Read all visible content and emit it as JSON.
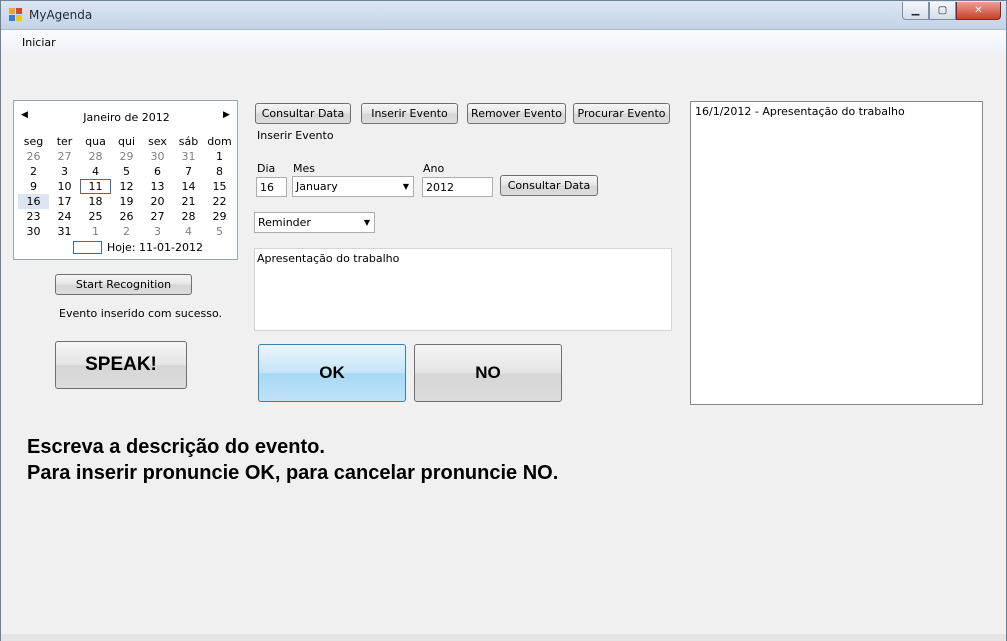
{
  "window": {
    "title": "MyAgenda",
    "minimize_icon": "minimize-icon",
    "maximize_icon": "maximize-icon",
    "close_icon": "close-icon"
  },
  "menu": {
    "iniciar": "Iniciar"
  },
  "calendar": {
    "month_label": "Janeiro de 2012",
    "prev_icon": "triangle-left-icon",
    "next_icon": "triangle-right-icon",
    "weekdays": [
      "seg",
      "ter",
      "qua",
      "qui",
      "sex",
      "sáb",
      "dom"
    ],
    "weeks": [
      [
        "26",
        "27",
        "28",
        "29",
        "30",
        "31",
        "1"
      ],
      [
        "2",
        "3",
        "4",
        "5",
        "6",
        "7",
        "8"
      ],
      [
        "9",
        "10",
        "11",
        "12",
        "13",
        "14",
        "15"
      ],
      [
        "16",
        "17",
        "18",
        "19",
        "20",
        "21",
        "22"
      ],
      [
        "23",
        "24",
        "25",
        "26",
        "27",
        "28",
        "29"
      ],
      [
        "30",
        "31",
        "1",
        "2",
        "3",
        "4",
        "5"
      ]
    ],
    "today_label": "Hoje: 11-01-2012"
  },
  "left": {
    "start_recognition": "Start Recognition",
    "status": "Evento inserido com sucesso.",
    "speak": "SPEAK!"
  },
  "toolbar": {
    "consultar_data": "Consultar Data",
    "inserir_evento": "Inserir Evento",
    "remover_evento": "Remover Evento",
    "procurar_evento": "Procurar Evento"
  },
  "mode_label": "Inserir Evento",
  "date_form": {
    "dia_label": "Dia",
    "dia_value": "16",
    "mes_label": "Mes",
    "mes_value": "January",
    "ano_label": "Ano",
    "ano_value": "2012",
    "consultar_button": "Consultar Data"
  },
  "type_select": {
    "value": "Reminder"
  },
  "description": {
    "value": "Apresentação do trabalho"
  },
  "ok_button": "OK",
  "no_button": "NO",
  "events_list": [
    "16/1/2012 - Apresentação do trabalho"
  ],
  "instructions": {
    "line1": "Escreva a descrição do evento.",
    "line2": "Para inserir pronuncie OK, para cancelar pronuncie NO."
  },
  "colors": {
    "ok_accent": "#a7d8f5",
    "close_button": "#c7402c",
    "titlebar": "#c4d3e6"
  }
}
